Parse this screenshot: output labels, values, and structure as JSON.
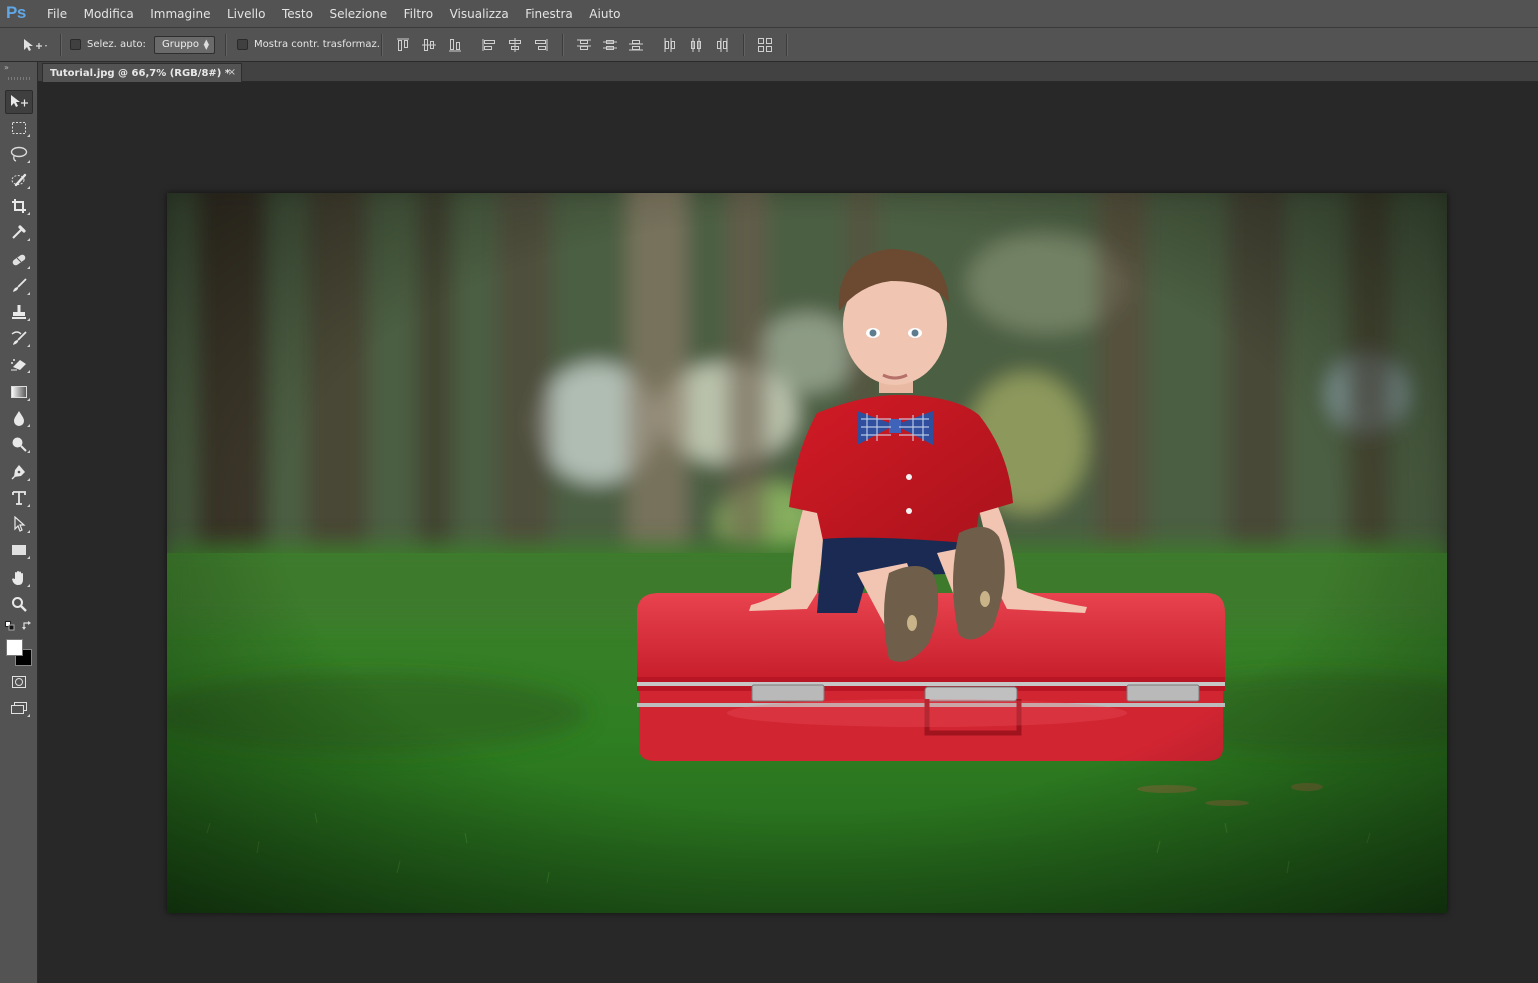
{
  "app": {
    "logo": "Ps",
    "menu": [
      "File",
      "Modifica",
      "Immagine",
      "Livello",
      "Testo",
      "Selezione",
      "Filtro",
      "Visualizza",
      "Finestra",
      "Aiuto"
    ]
  },
  "options_bar": {
    "auto_select_label": "Selez. auto:",
    "auto_select_checked": false,
    "group_value": "Gruppo",
    "show_transform_label": "Mostra contr. trasformaz.",
    "show_transform_checked": false
  },
  "document": {
    "tab_title": "Tutorial.jpg @ 66,7% (RGB/8#) *",
    "close_glyph": "×"
  },
  "colors": {
    "foreground": "#ffffff",
    "background": "#000000",
    "accent": "#5fa7e6"
  },
  "tools": [
    "move-icon",
    "rectangular-marquee-icon",
    "lasso-icon",
    "quick-selection-icon",
    "crop-icon",
    "eyedropper-icon",
    "healing-brush-icon",
    "brush-icon",
    "clone-stamp-icon",
    "history-brush-icon",
    "eraser-icon",
    "gradient-icon",
    "blur-icon",
    "dodge-icon",
    "pen-icon",
    "type-icon",
    "path-selection-icon",
    "rectangle-shape-icon",
    "hand-icon",
    "zoom-icon",
    "quick-mask-icon",
    "screen-mode-icon"
  ]
}
